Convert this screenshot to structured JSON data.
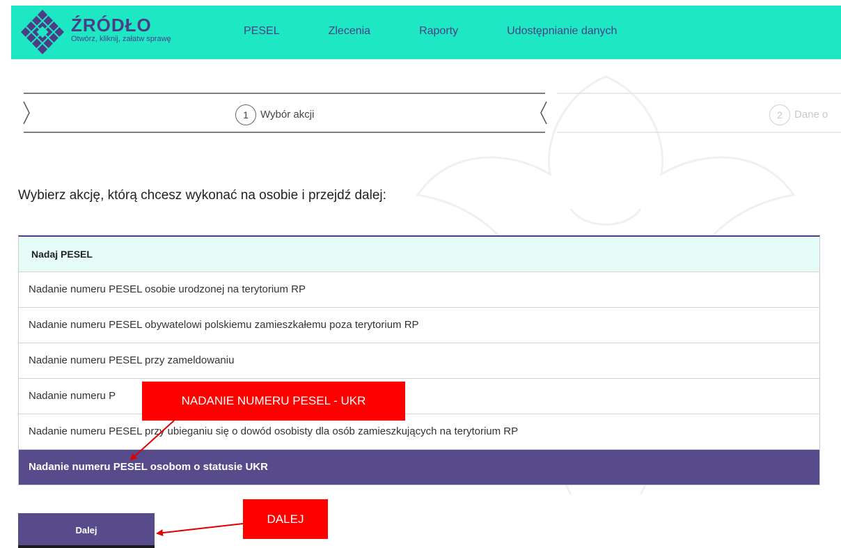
{
  "header": {
    "brand_name": "ŹRÓDŁO",
    "brand_tagline": "Otwórz, kliknij, załatw sprawę",
    "logo_icon": "diamond-lattice-logo",
    "nav": [
      "PESEL",
      "Zlecenia",
      "Raporty",
      "Udostępnianie danych"
    ]
  },
  "stepper": {
    "steps": [
      {
        "number": "1",
        "label": "Wybór akcji",
        "active": true
      },
      {
        "number": "2",
        "label": "Dane o",
        "active": false
      }
    ]
  },
  "page": {
    "title": "Wybierz akcję, którą chcesz wykonać na osobie i przejdź dalej:"
  },
  "actions": {
    "group_header": "Nadaj PESEL",
    "items": [
      "Nadanie numeru PESEL osobie urodzonej na terytorium RP",
      "Nadanie numeru PESEL obywatelowi polskiemu zamieszkałemu poza terytorium RP",
      "Nadanie numeru PESEL przy zameldowaniu",
      "Nadanie numeru P",
      "Nadanie numeru PESEL przy ubieganiu się o dowód osobisty dla osób zamieszkujących na terytorium RP",
      "Nadanie numeru PESEL osobom o statusie UKR"
    ],
    "selected_index": 5
  },
  "buttons": {
    "next_label": "Dalej"
  },
  "annotations": {
    "ukr_label": "NADANIE NUMERU PESEL - UKR",
    "dalej_label": "DALEJ"
  },
  "colors": {
    "header_bg": "#1ee8c4",
    "brand": "#4b3e86",
    "selected_row": "#574b8c",
    "callout": "#ff0000"
  }
}
